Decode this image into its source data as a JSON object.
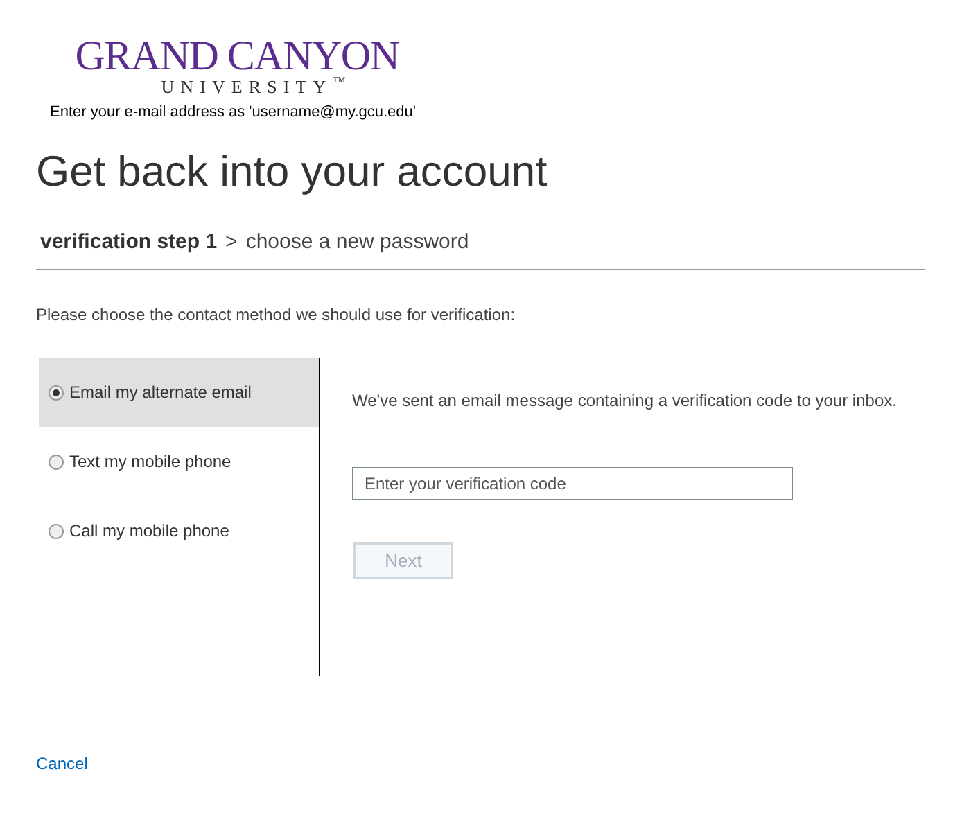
{
  "logo": {
    "name": "GRAND CANYON",
    "subtitle": "UNIVERSITY$^{™}$"
  },
  "instruction": "Enter your e-mail address as 'username@my.gcu.edu'",
  "title": "Get back into your account",
  "breadcrumb": [
    {
      "label": "verification step 1",
      "selected": true
    },
    {
      "label": ">",
      "selected": false
    },
    {
      "label": "choose a new password",
      "selected": false
    }
  ],
  "prompt": "Please choose the contact method we should use for verification:",
  "methods": [
    {
      "label": "Email my alternate email",
      "selected": true
    },
    {
      "label": "Text my mobile phone",
      "selected": false
    },
    {
      "label": "Call my mobile phone",
      "selected": false
    }
  ],
  "message": "We've sent an email message containing a verification code to your inbox.",
  "code_field": {
    "placeholder": "Enter your verification code"
  },
  "next_button": {
    "label": "Next",
    "disabled": true
  },
  "cancel_link": "Cancel"
}
